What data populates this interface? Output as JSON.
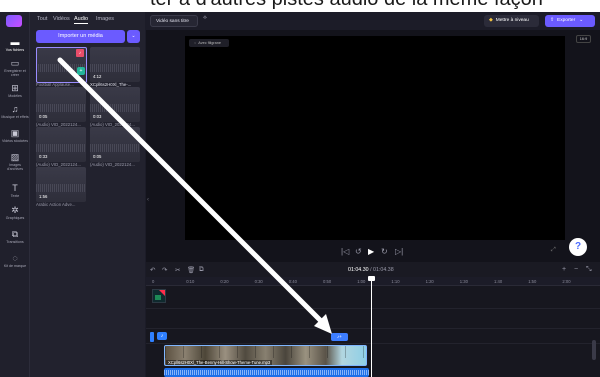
{
  "caption": {
    "text": "ter à d'autres pistes audio de la même façon"
  },
  "rail": [
    {
      "label": "Vos fichiers",
      "icon": "folder-icon",
      "glyph": "▬"
    },
    {
      "label": "Enregistrer et créer",
      "icon": "record-icon",
      "glyph": "▭"
    },
    {
      "label": "Modèles",
      "icon": "templates-icon",
      "glyph": "⊞"
    },
    {
      "label": "Musique et effets",
      "icon": "music-icon",
      "glyph": "♫"
    },
    {
      "label": "Vidéos stockées",
      "icon": "video-icon",
      "glyph": "▣"
    },
    {
      "label": "Images d'archives",
      "icon": "image-icon",
      "glyph": "▨"
    },
    {
      "label": "Texte",
      "icon": "text-icon",
      "glyph": "T"
    },
    {
      "label": "Graphiques",
      "icon": "graphics-icon",
      "glyph": "✲"
    },
    {
      "label": "Transitions",
      "icon": "transitions-icon",
      "glyph": "⧉"
    },
    {
      "label": "Kit de marque",
      "icon": "brand-kit-icon",
      "glyph": "◌"
    }
  ],
  "media_panel": {
    "tabs": [
      "Tout",
      "Vidéos",
      "Audio",
      "Images"
    ],
    "active_tab": "Audio",
    "import_label": "Importer un média",
    "import_caret": "⌄",
    "items": [
      {
        "label": "Football Applause...",
        "duration": ""
      },
      {
        "label": "XCpll6s2H0Xl_The-...",
        "duration": "4:12"
      },
      {
        "label": "(Audio) VID_2022124...",
        "duration": "0:05"
      },
      {
        "label": "(Audio) VID_2022124...",
        "duration": "0:03"
      },
      {
        "label": "(Audio) VID_2022124...",
        "duration": "0:33"
      },
      {
        "label": "(Audio) VID_2022124...",
        "duration": "0:05"
      },
      {
        "label": "Arabic Action Adve...",
        "duration": "1:56"
      }
    ]
  },
  "topbar": {
    "project_title": "Vidéo sans titre",
    "upgrade_label": "Mettre à niveau",
    "export_label": "Exporter"
  },
  "preview": {
    "watermark_label": "Avec filigrane",
    "aspect_ratio": "16:9",
    "controls": [
      "|◁",
      "↺",
      "▶",
      "↻",
      "▷|"
    ]
  },
  "help_label": "?",
  "timeline": {
    "current_time": "01:04.30",
    "total_time": "01:04.38",
    "separator": " / ",
    "ruler_ticks": [
      "0",
      "0:10",
      "0:20",
      "0:30",
      "0:40",
      "0:50",
      "1:00",
      "1:10",
      "1:20",
      "1:30",
      "1:40",
      "1:50",
      "2:00"
    ],
    "video_clip_label": "XCpll6s2H0Xl_The-Benny-Hill-Show-Theme-Tune.mp3"
  },
  "colors": {
    "accent": "#6b5bff",
    "audio_track": "#1f6fe8",
    "playhead": "#ffffff"
  }
}
